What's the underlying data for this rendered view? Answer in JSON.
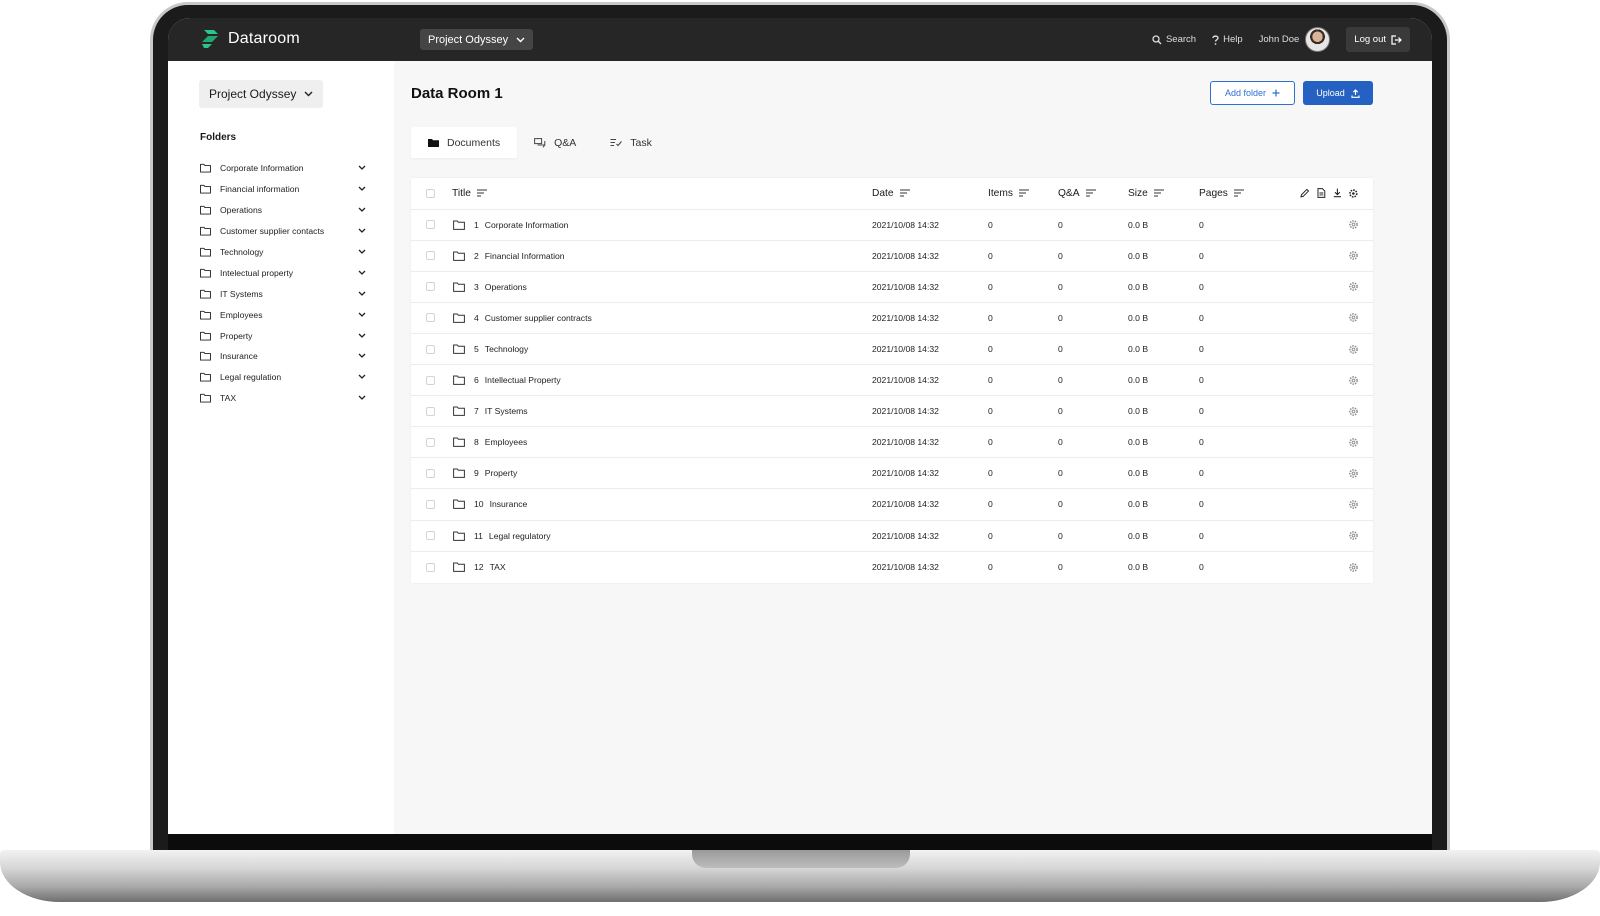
{
  "topbar": {
    "brand": "Dataroom",
    "project": "Project Odyssey",
    "search": "Search",
    "help": "Help",
    "user": "John Doe",
    "logout": "Log out"
  },
  "sidebar": {
    "project": "Project Odyssey",
    "heading": "Folders",
    "folders": [
      "Corporate Information",
      "Financial information",
      "Operations",
      "Customer supplier contacts",
      "Technology",
      "Intelectual property",
      "IT Systems",
      "Employees",
      "Property",
      "Insurance",
      "Legal regulation",
      "TAX"
    ]
  },
  "main": {
    "title": "Data Room 1",
    "add_folder": "Add folder",
    "upload": "Upload",
    "tabs": [
      "Documents",
      "Q&A",
      "Task"
    ],
    "columns": {
      "title": "Title",
      "date": "Date",
      "items": "Items",
      "qa": "Q&A",
      "size": "Size",
      "pages": "Pages"
    },
    "rows": [
      {
        "num": "1",
        "name": "Corporate Information",
        "date": "2021/10/08 14:32",
        "items": "0",
        "qa": "0",
        "size": "0.0 B",
        "pages": "0"
      },
      {
        "num": "2",
        "name": "Financial Information",
        "date": "2021/10/08 14:32",
        "items": "0",
        "qa": "0",
        "size": "0.0 B",
        "pages": "0"
      },
      {
        "num": "3",
        "name": "Operations",
        "date": "2021/10/08 14:32",
        "items": "0",
        "qa": "0",
        "size": "0.0 B",
        "pages": "0"
      },
      {
        "num": "4",
        "name": "Customer supplier contracts",
        "date": "2021/10/08 14:32",
        "items": "0",
        "qa": "0",
        "size": "0.0 B",
        "pages": "0"
      },
      {
        "num": "5",
        "name": "Technology",
        "date": "2021/10/08 14:32",
        "items": "0",
        "qa": "0",
        "size": "0.0 B",
        "pages": "0"
      },
      {
        "num": "6",
        "name": "Intellectual Property",
        "date": "2021/10/08 14:32",
        "items": "0",
        "qa": "0",
        "size": "0.0 B",
        "pages": "0"
      },
      {
        "num": "7",
        "name": "IT Systems",
        "date": "2021/10/08 14:32",
        "items": "0",
        "qa": "0",
        "size": "0.0 B",
        "pages": "0"
      },
      {
        "num": "8",
        "name": "Employees",
        "date": "2021/10/08 14:32",
        "items": "0",
        "qa": "0",
        "size": "0.0 B",
        "pages": "0"
      },
      {
        "num": "9",
        "name": "Property",
        "date": "2021/10/08 14:32",
        "items": "0",
        "qa": "0",
        "size": "0.0 B",
        "pages": "0"
      },
      {
        "num": "10",
        "name": "Insurance",
        "date": "2021/10/08 14:32",
        "items": "0",
        "qa": "0",
        "size": "0.0 B",
        "pages": "0"
      },
      {
        "num": "11",
        "name": "Legal regulatory",
        "date": "2021/10/08 14:32",
        "items": "0",
        "qa": "0",
        "size": "0.0 B",
        "pages": "0"
      },
      {
        "num": "12",
        "name": "TAX",
        "date": "2021/10/08 14:32",
        "items": "0",
        "qa": "0",
        "size": "0.0 B",
        "pages": "0"
      }
    ]
  },
  "colors": {
    "accent": "#2461c2",
    "brand_green": "#2bc48a",
    "topbar": "#262626"
  },
  "icons": {
    "brand": "dataroom-logo-icon",
    "folder": "folder-icon",
    "chevron": "chevron-down-icon",
    "sort": "sort-icon",
    "row_settings": "gear-icon"
  }
}
